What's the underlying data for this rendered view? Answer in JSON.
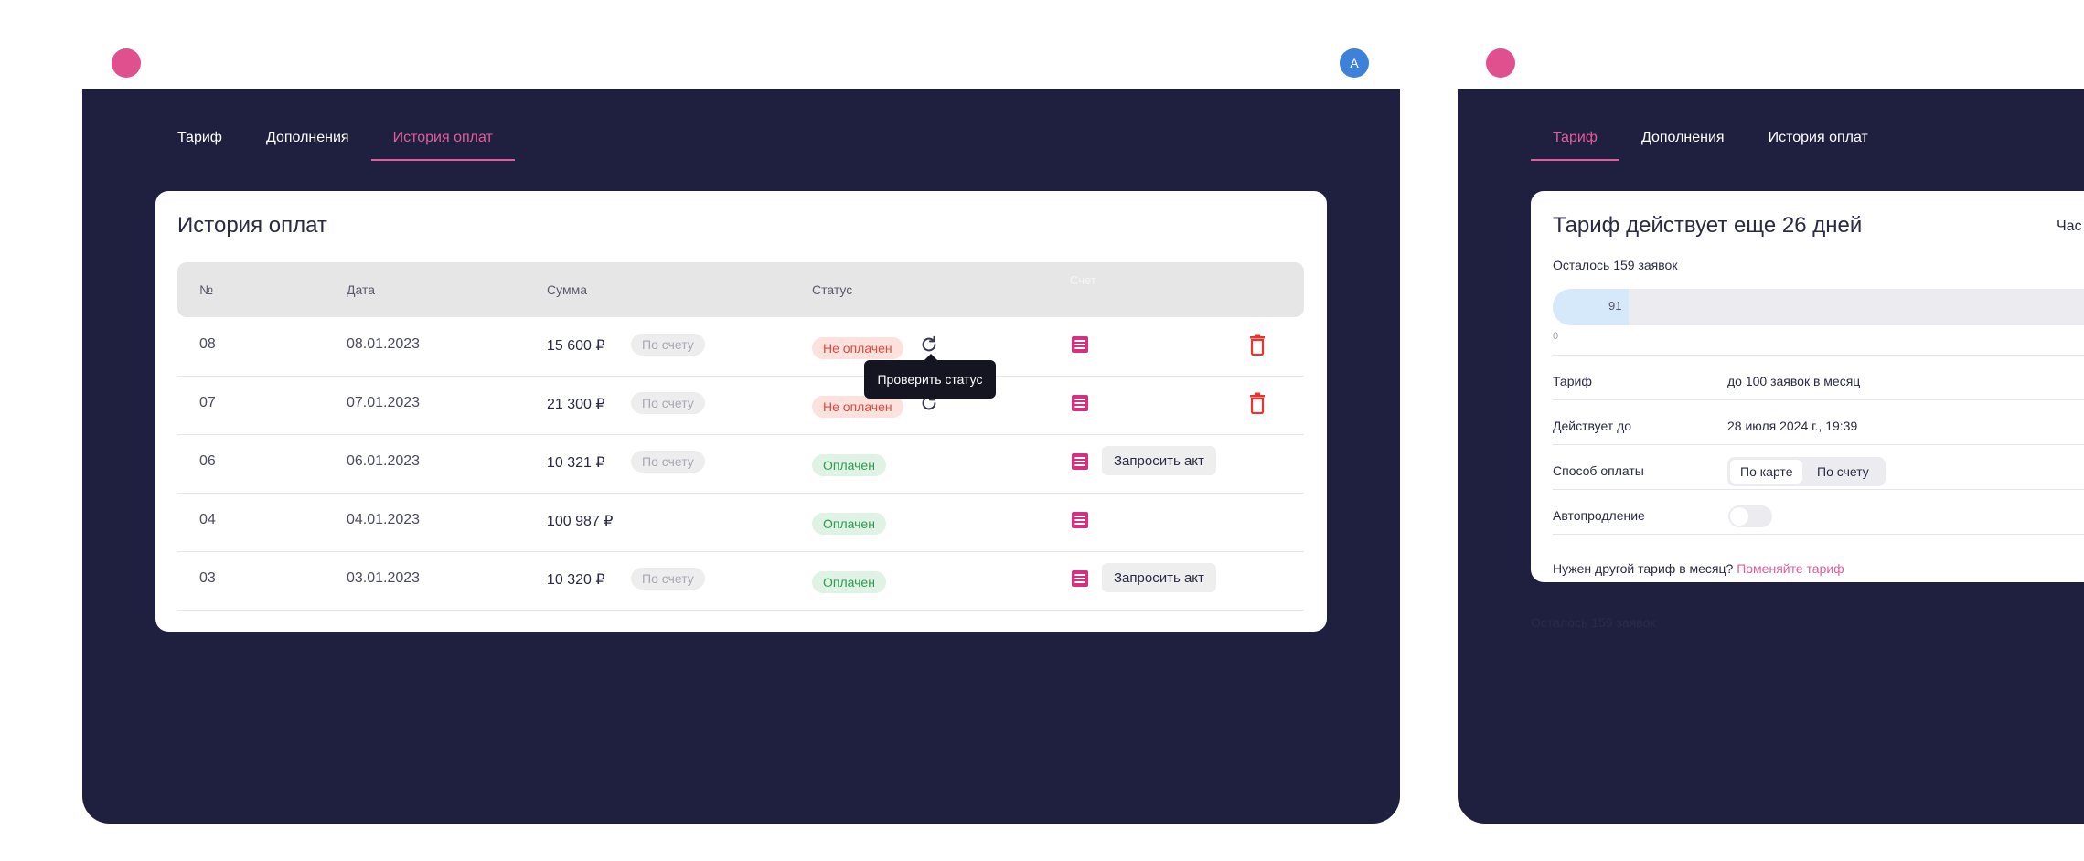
{
  "left_panel": {
    "avatar_letter": "A",
    "tabs": [
      {
        "label": "Тариф"
      },
      {
        "label": "Дополнения"
      },
      {
        "label": "История оплат",
        "active": true
      }
    ],
    "card": {
      "title": "История оплат",
      "columns": [
        "№",
        "Дата",
        "Сумма",
        "Статус",
        "Счет"
      ],
      "rows": [
        {
          "num": "08",
          "date": "08.01.2023",
          "sum": "15 600 ₽",
          "method": "По счету",
          "status": "Не оплачен"
        },
        {
          "num": "07",
          "date": "07.01.2023",
          "sum": "21 300 ₽",
          "method": "По счету",
          "status": "Не оплачен"
        },
        {
          "num": "06",
          "date": "06.01.2023",
          "sum": "10 321 ₽",
          "method": "По счету",
          "status": "Оплачен",
          "act_button": "Запросить акт"
        },
        {
          "num": "04",
          "date": "04.01.2023",
          "sum": "100 987 ₽",
          "status": "Оплачен"
        },
        {
          "num": "03",
          "date": "03.01.2023",
          "sum": "10 320 ₽",
          "method": "По счету",
          "status": "Оплачен",
          "act_button": "Запросить акт"
        }
      ],
      "tooltip": "Проверить статус"
    }
  },
  "right_panel": {
    "tabs": [
      {
        "label": "Тариф",
        "active": true
      },
      {
        "label": "Дополнения"
      },
      {
        "label": "История оплат"
      }
    ],
    "card": {
      "title": "Тариф действует еще 26 дней",
      "title_cut": "Час",
      "remaining": "Осталось 159 заявок",
      "progress_value": "91",
      "progress_fraction": 0.119,
      "progress_min": "0",
      "details": [
        {
          "label": "Тариф",
          "value": "до 100 заявок в месяц"
        },
        {
          "label": "Действует до",
          "value": "28 июля 2024 г., 19:39"
        },
        {
          "label": "Способ оплаты"
        },
        {
          "label": "Автопродление"
        }
      ],
      "payment_options": [
        "По карте",
        "По счету"
      ],
      "payment_selected": "По карте",
      "autorenew": false,
      "footer_text": "Нужен другой тариф в месяц?",
      "footer_link": "Поменяйте тариф"
    },
    "ghost_text": "Осталось 159 заявок"
  },
  "colors": {
    "background": "#ffffff",
    "panel": "#1f1f3f",
    "accent": "#e35d9c",
    "avatar": "#3d82d8",
    "danger": "#e04a3a",
    "success": "#2f9a4d"
  }
}
